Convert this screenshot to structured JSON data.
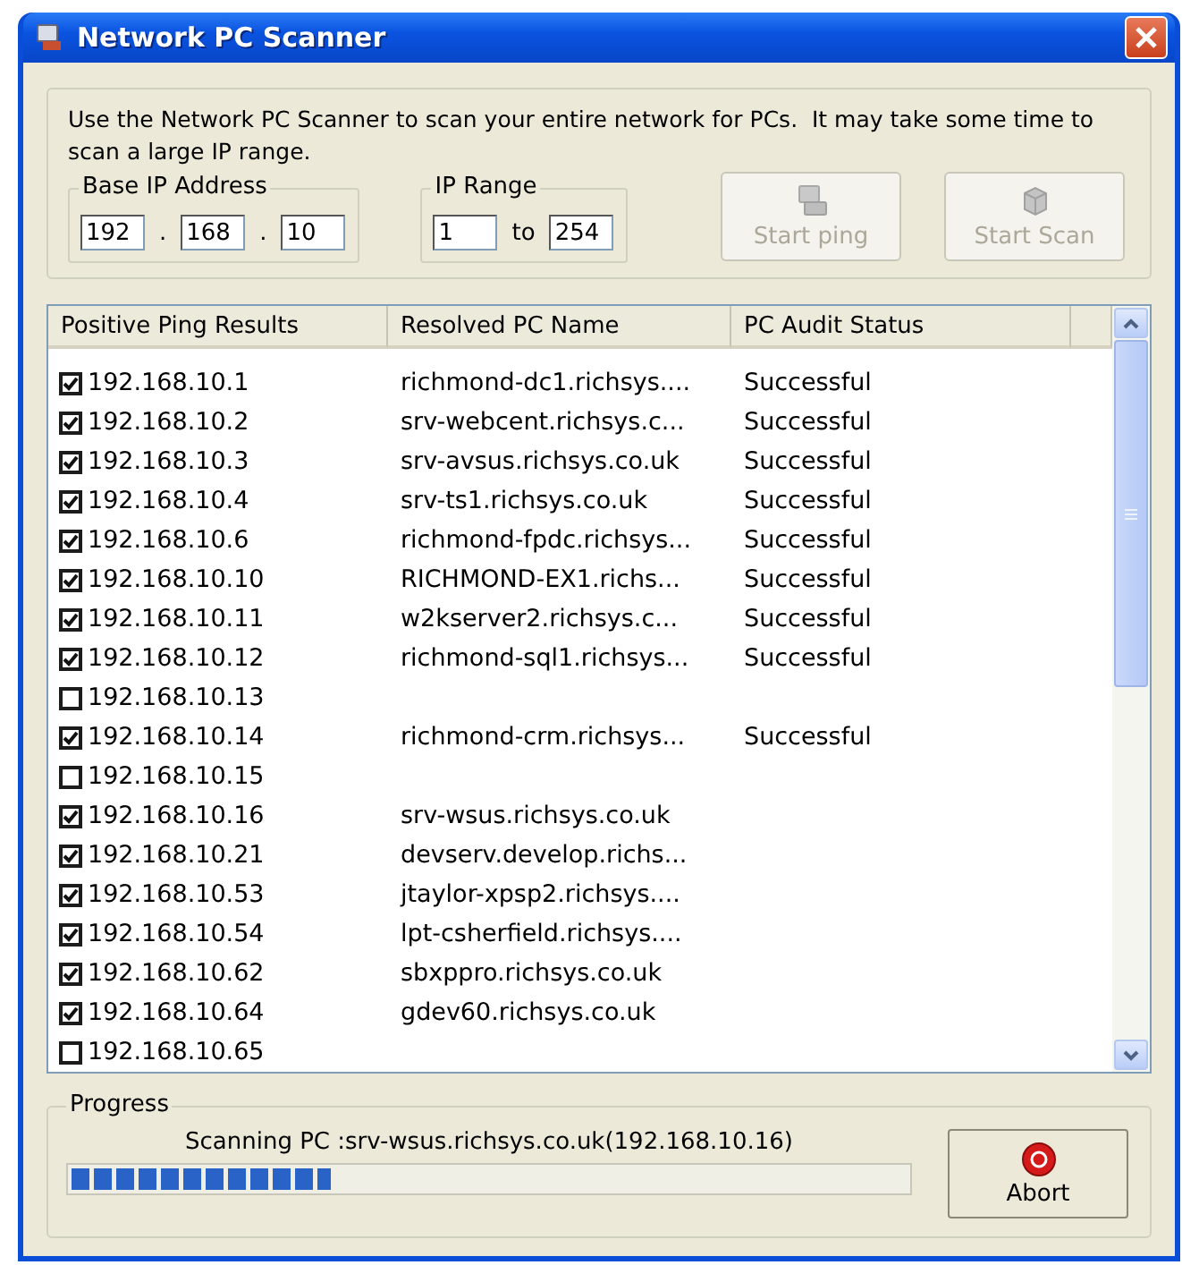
{
  "window": {
    "title": "Network PC Scanner"
  },
  "intro": "Use the Network PC Scanner to scan your entire network for PCs.  It may take some time to scan a large IP range.",
  "base_ip": {
    "label": "Base IP Address",
    "octets": [
      "192",
      "168",
      "10"
    ],
    "separator": "."
  },
  "ip_range": {
    "label": "IP Range",
    "from": "1",
    "to_label": "to",
    "to": "254"
  },
  "buttons": [
    {
      "label": "Start ping",
      "disabled": true,
      "kind": "ping"
    },
    {
      "label": "Start Scan",
      "disabled": true,
      "kind": "scan"
    }
  ],
  "table": {
    "columns": [
      "Positive Ping Results",
      "Resolved PC Name",
      "PC Audit Status"
    ],
    "rows": [
      {
        "ip": "192.168.10.1",
        "checked": true,
        "name": "richmond-dc1.richsys....",
        "status": "Successful"
      },
      {
        "ip": "192.168.10.2",
        "checked": true,
        "name": "srv-webcent.richsys.c...",
        "status": "Successful"
      },
      {
        "ip": "192.168.10.3",
        "checked": true,
        "name": "srv-avsus.richsys.co.uk",
        "status": "Successful"
      },
      {
        "ip": "192.168.10.4",
        "checked": true,
        "name": "srv-ts1.richsys.co.uk",
        "status": "Successful"
      },
      {
        "ip": "192.168.10.6",
        "checked": true,
        "name": "richmond-fpdc.richsys...",
        "status": "Successful"
      },
      {
        "ip": "192.168.10.10",
        "checked": true,
        "name": "RICHMOND-EX1.richs...",
        "status": "Successful"
      },
      {
        "ip": "192.168.10.11",
        "checked": true,
        "name": "w2kserver2.richsys.c...",
        "status": "Successful"
      },
      {
        "ip": "192.168.10.12",
        "checked": true,
        "name": "richmond-sql1.richsys...",
        "status": "Successful"
      },
      {
        "ip": "192.168.10.13",
        "checked": false
      },
      {
        "ip": "192.168.10.14",
        "checked": true,
        "name": "richmond-crm.richsys...",
        "status": "Successful"
      },
      {
        "ip": "192.168.10.15",
        "checked": false
      },
      {
        "ip": "192.168.10.16",
        "checked": true,
        "name": "srv-wsus.richsys.co.uk"
      },
      {
        "ip": "192.168.10.21",
        "checked": true,
        "name": "devserv.develop.richs..."
      },
      {
        "ip": "192.168.10.53",
        "checked": true,
        "name": "jtaylor-xpsp2.richsys...."
      },
      {
        "ip": "192.168.10.54",
        "checked": true,
        "name": "lpt-csherfield.richsys...."
      },
      {
        "ip": "192.168.10.62",
        "checked": true,
        "name": "sbxppro.richsys.co.uk"
      },
      {
        "ip": "192.168.10.64",
        "checked": true,
        "name": "gdev60.richsys.co.uk"
      },
      {
        "ip": "192.168.10.65",
        "checked": false
      }
    ]
  },
  "progress": {
    "label": "Progress",
    "message": "Scanning PC :srv-wsus.richsys.co.uk(192.168.10.16)",
    "level": 0.31,
    "abort": "Abort"
  }
}
